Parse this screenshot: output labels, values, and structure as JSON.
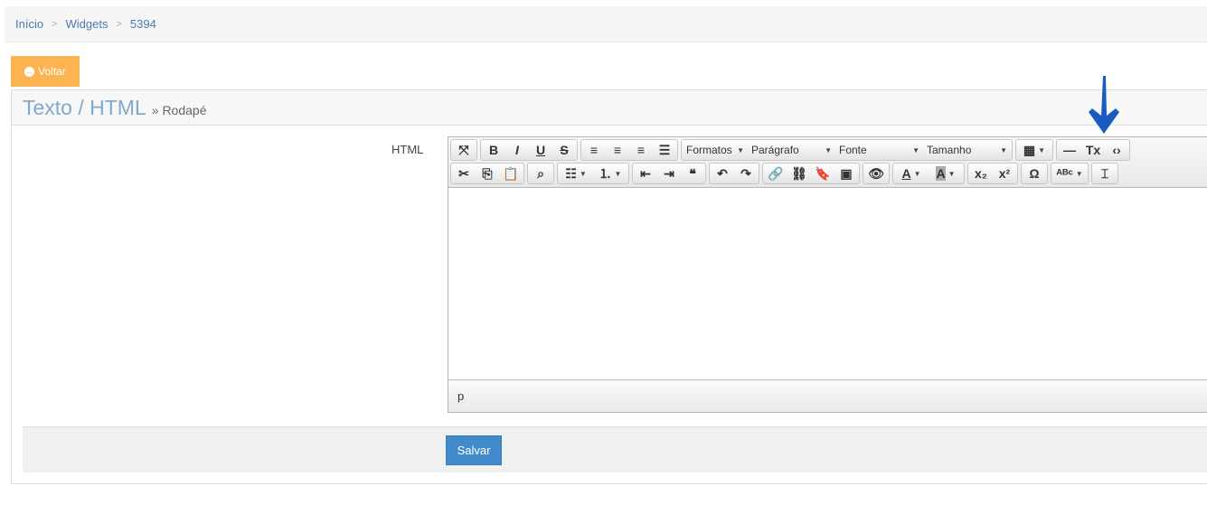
{
  "breadcrumb": [
    "Início",
    "Widgets",
    "5394"
  ],
  "back_label": "Voltar",
  "panel": {
    "title": "Texto / HTML",
    "subtitle": "» Rodapé"
  },
  "field_label": "HTML",
  "editor": {
    "row1": [
      [
        {
          "icon": "maximize"
        }
      ],
      [
        {
          "icon": "bold"
        },
        {
          "icon": "italic"
        },
        {
          "icon": "underline"
        },
        {
          "icon": "strikethrough"
        }
      ],
      [
        {
          "icon": "align-left"
        },
        {
          "icon": "align-center"
        },
        {
          "icon": "align-right"
        },
        {
          "icon": "align-justify"
        }
      ],
      [
        {
          "combo": "Formatos",
          "w": 72
        },
        {
          "combo": "Parágrafo",
          "w": 97
        },
        {
          "combo": "Fonte",
          "w": 97
        },
        {
          "combo": "Tamanho",
          "w": 97
        }
      ],
      [
        {
          "icon": "table",
          "dd": true
        }
      ],
      [
        {
          "icon": "horizontal-rule"
        },
        {
          "icon": "remove-format"
        },
        {
          "icon": "source-code"
        }
      ]
    ],
    "row2": [
      [
        {
          "icon": "cut"
        },
        {
          "icon": "copy"
        },
        {
          "icon": "paste"
        }
      ],
      [
        {
          "icon": "find"
        }
      ],
      [
        {
          "icon": "bullet-list",
          "dd": true
        },
        {
          "icon": "numbered-list",
          "dd": true
        }
      ],
      [
        {
          "icon": "outdent"
        },
        {
          "icon": "indent"
        },
        {
          "icon": "blockquote"
        }
      ],
      [
        {
          "icon": "undo"
        },
        {
          "icon": "redo"
        }
      ],
      [
        {
          "icon": "link"
        },
        {
          "icon": "unlink"
        },
        {
          "icon": "anchor"
        },
        {
          "icon": "image"
        }
      ],
      [
        {
          "icon": "preview"
        }
      ],
      [
        {
          "icon": "text-color",
          "dd": true
        },
        {
          "icon": "background-color",
          "dd": true
        }
      ],
      [
        {
          "icon": "subscript"
        },
        {
          "icon": "superscript"
        }
      ],
      [
        {
          "icon": "special-character"
        }
      ],
      [
        {
          "icon": "spellcheck",
          "dd": true
        }
      ],
      [
        {
          "icon": "page-break"
        }
      ]
    ],
    "path": "p"
  },
  "save_label": "Salvar",
  "colors": {
    "accent": "#428bca",
    "back": "#fbb450",
    "arrow": "#1a5bbf"
  }
}
